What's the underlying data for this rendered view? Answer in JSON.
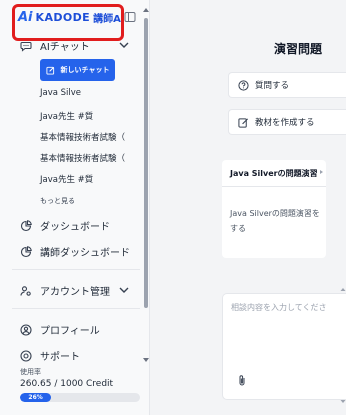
{
  "brand": {
    "logo_mark": "Ai",
    "name": "KADODE",
    "sub": "講師AI"
  },
  "sidebar": {
    "ai_chat": {
      "label": "AIチャット",
      "icon": "chat-icon"
    },
    "new_chat_label": "新しいチャット",
    "history": [
      "Java Silve",
      "Java先生 #質",
      "基本情報技術者試験（",
      "基本情報技術者試験（",
      "Java先生 #質"
    ],
    "more_label": "もっと見る",
    "dashboard": "ダッシュボード",
    "teacher_dashboard": "講師ダッシュボード",
    "account": "アカウント管理",
    "profile": "プロフィール",
    "support": "サポート"
  },
  "usage": {
    "label": "使用率",
    "value_text": "260.65 / 1000 Credit",
    "percent_text": "26%",
    "percent": 26
  },
  "main": {
    "title": "演習問題",
    "ask_label": "質問する",
    "create_material_label": "教材を作成する",
    "card": {
      "title": "Java Silverの問題演習",
      "description": "Java Silverの問題演習をする"
    },
    "input_placeholder": "相談内容を入力してくださ"
  },
  "colors": {
    "accent": "#2563eb",
    "highlight": "#e11d1d"
  }
}
